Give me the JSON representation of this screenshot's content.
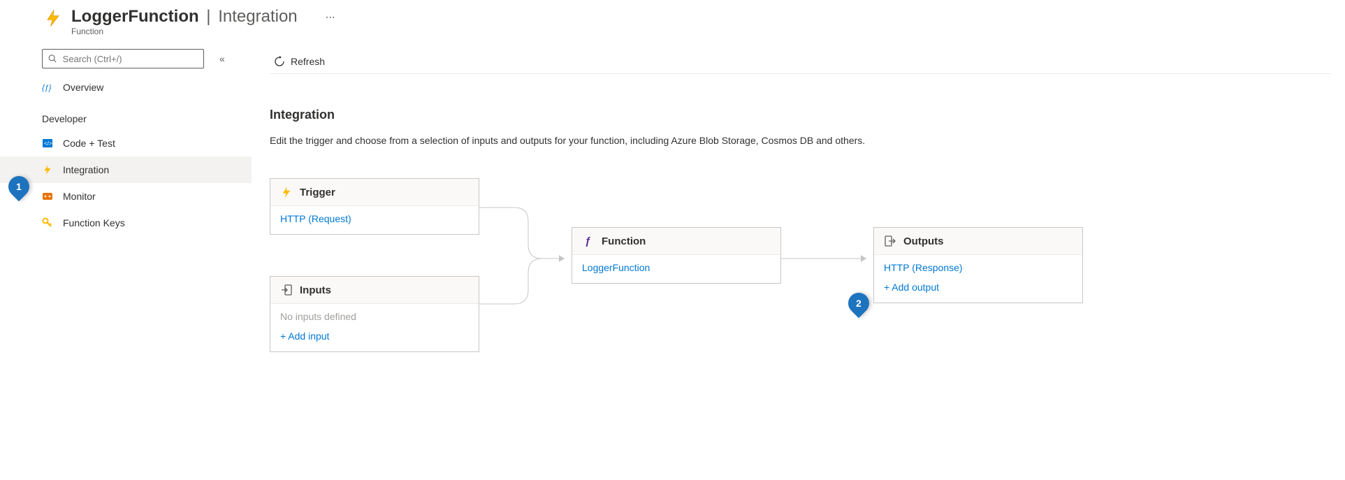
{
  "header": {
    "title_strong": "LoggerFunction",
    "title_light": "Integration",
    "subtitle": "Function"
  },
  "search": {
    "placeholder": "Search (Ctrl+/)"
  },
  "sidebar": {
    "overview_label": "Overview",
    "section_label": "Developer",
    "items": [
      {
        "label": "Code + Test"
      },
      {
        "label": "Integration"
      },
      {
        "label": "Monitor"
      },
      {
        "label": "Function Keys"
      }
    ]
  },
  "toolbar": {
    "refresh_label": "Refresh"
  },
  "content": {
    "heading": "Integration",
    "description": "Edit the trigger and choose from a selection of inputs and outputs for your function, including Azure Blob Storage, Cosmos DB and others."
  },
  "cards": {
    "trigger": {
      "title": "Trigger",
      "link": "HTTP (Request)"
    },
    "inputs": {
      "title": "Inputs",
      "empty": "No inputs defined",
      "add": "+ Add input"
    },
    "function": {
      "title": "Function",
      "link": "LoggerFunction"
    },
    "outputs": {
      "title": "Outputs",
      "link": "HTTP (Response)",
      "add": "+ Add output"
    }
  },
  "callouts": {
    "one": "1",
    "two": "2"
  }
}
